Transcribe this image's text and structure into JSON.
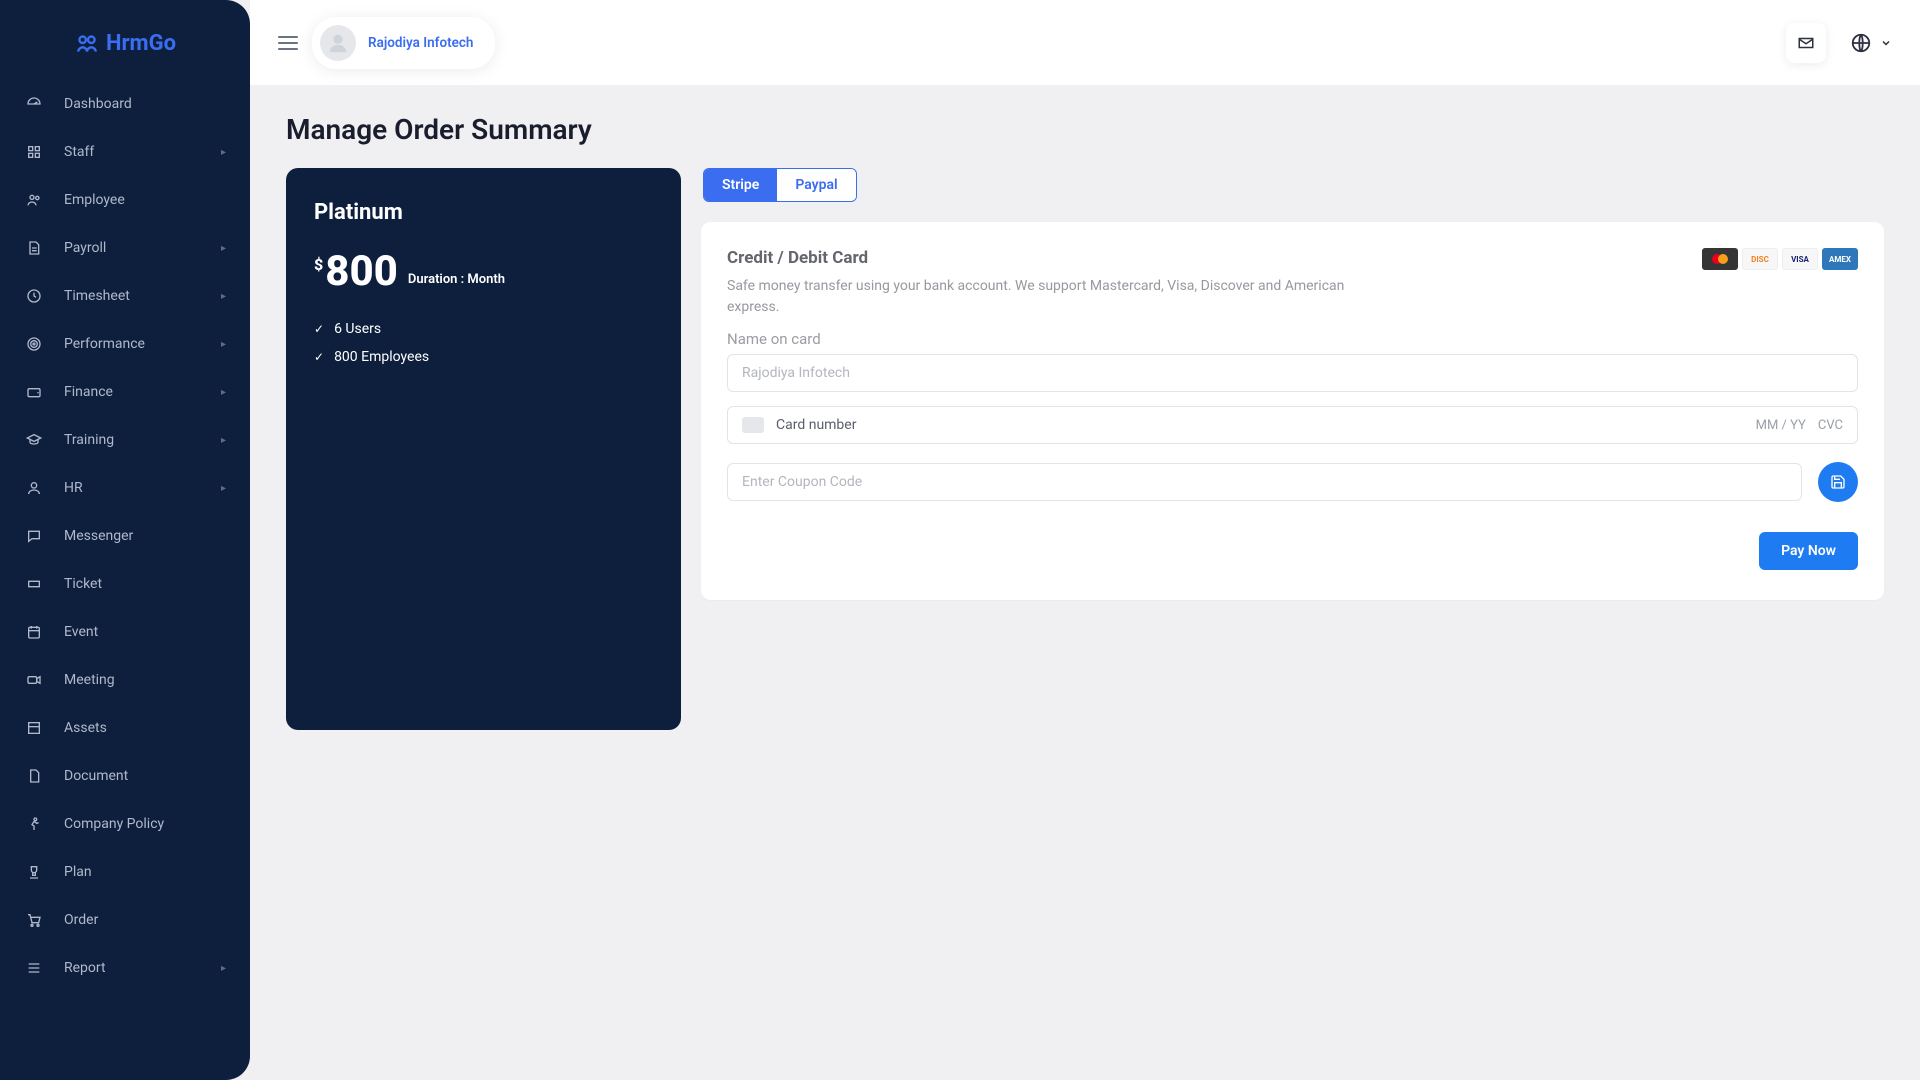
{
  "brand": {
    "name": "HrmGo"
  },
  "user": {
    "name": "Rajodiya Infotech"
  },
  "sidebar": {
    "items": [
      {
        "label": "Dashboard",
        "icon": "gauge",
        "expandable": false
      },
      {
        "label": "Staff",
        "icon": "grid",
        "expandable": true
      },
      {
        "label": "Employee",
        "icon": "users",
        "expandable": false
      },
      {
        "label": "Payroll",
        "icon": "file",
        "expandable": true
      },
      {
        "label": "Timesheet",
        "icon": "clock",
        "expandable": true
      },
      {
        "label": "Performance",
        "icon": "target",
        "expandable": true
      },
      {
        "label": "Finance",
        "icon": "wallet",
        "expandable": true
      },
      {
        "label": "Training",
        "icon": "grad-cap",
        "expandable": true
      },
      {
        "label": "HR",
        "icon": "user",
        "expandable": true
      },
      {
        "label": "Messenger",
        "icon": "chat",
        "expandable": false
      },
      {
        "label": "Ticket",
        "icon": "ticket",
        "expandable": false
      },
      {
        "label": "Event",
        "icon": "calendar",
        "expandable": false
      },
      {
        "label": "Meeting",
        "icon": "video",
        "expandable": false
      },
      {
        "label": "Assets",
        "icon": "box",
        "expandable": false
      },
      {
        "label": "Document",
        "icon": "doc",
        "expandable": false
      },
      {
        "label": "Company Policy",
        "icon": "run",
        "expandable": false
      },
      {
        "label": "Plan",
        "icon": "trophy",
        "expandable": false
      },
      {
        "label": "Order",
        "icon": "cart",
        "expandable": false
      },
      {
        "label": "Report",
        "icon": "list",
        "expandable": true
      }
    ]
  },
  "page": {
    "title": "Manage Order Summary"
  },
  "plan": {
    "name": "Platinum",
    "currency": "$",
    "price": "800",
    "durationLabel": "Duration : Month",
    "features": [
      "6 Users",
      "800 Employees"
    ]
  },
  "tabs": {
    "stripe": "Stripe",
    "paypal": "Paypal",
    "active": "stripe"
  },
  "payment": {
    "title": "Credit / Debit Card",
    "description": "Safe money transfer using your bank account. We support Mastercard, Visa, Discover and American express.",
    "nameLabel": "Name on card",
    "namePlaceholder": "Rajodiya Infotech",
    "cardNumberLabel": "Card number",
    "cardExpiryLabel": "MM / YY",
    "cardCvcLabel": "CVC",
    "couponPlaceholder": "Enter Coupon Code",
    "payButton": "Pay Now",
    "brands": [
      "mastercard",
      "discover",
      "visa",
      "amex"
    ]
  }
}
